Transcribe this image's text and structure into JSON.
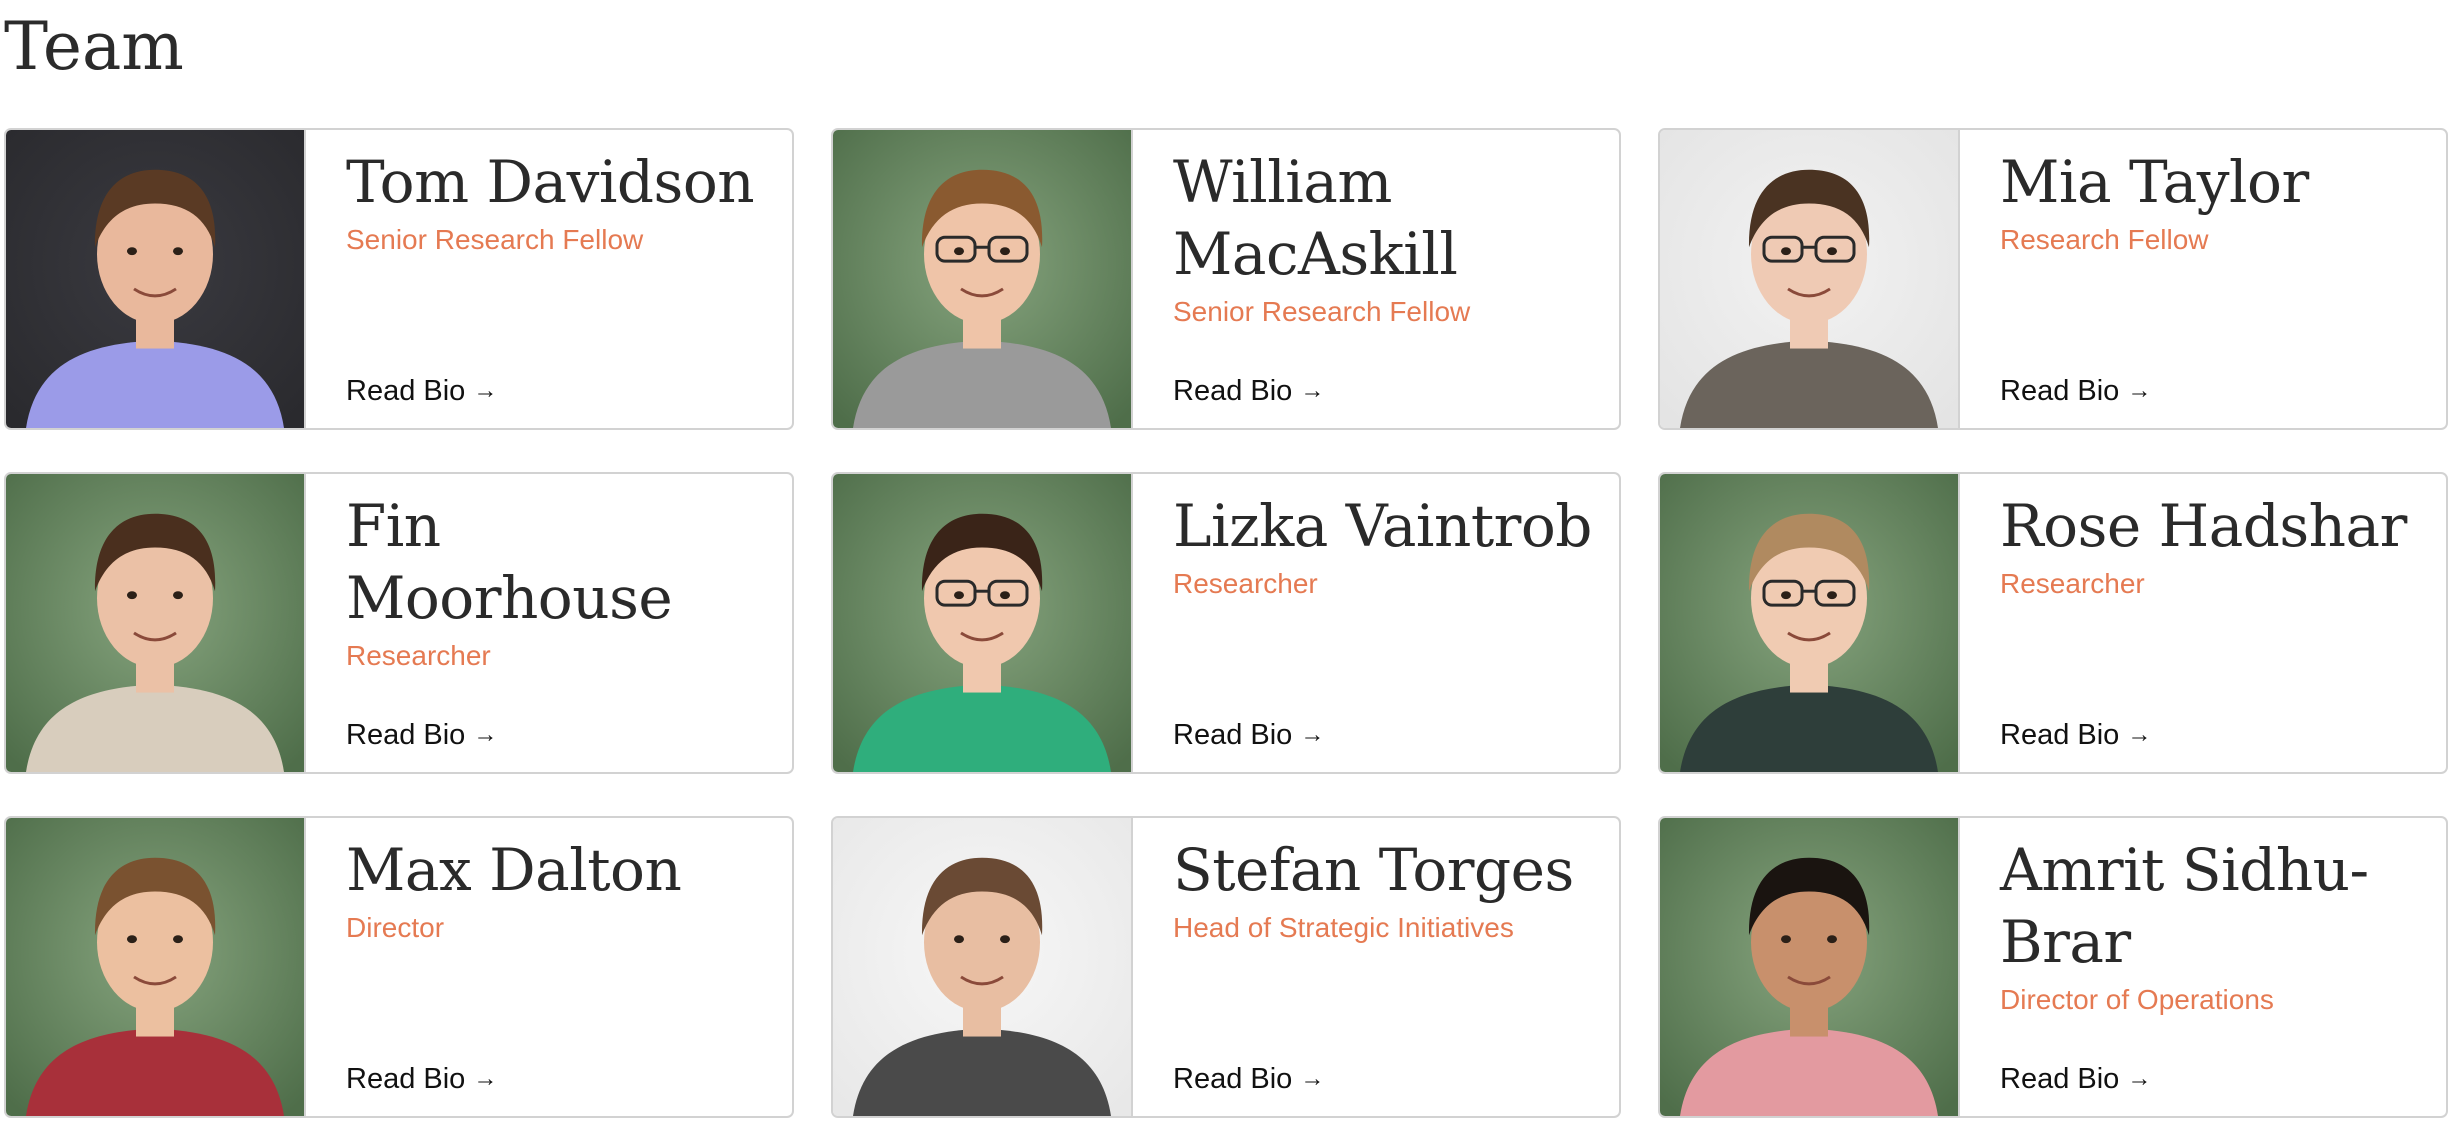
{
  "page": {
    "title": "Team"
  },
  "read_bio_label": "Read Bio",
  "read_bio_arrow": "→",
  "members": [
    {
      "name": "Tom Davidson",
      "role": "Senior Research Fellow",
      "bg": "#2a2a2e",
      "bg_light": "#3a3a40",
      "shirt": "#9b9be8",
      "hair": "#5a3a24",
      "skin": "#e9b89c",
      "glasses": false
    },
    {
      "name": "William MacAskill",
      "role": "Senior Research Fellow",
      "bg": "#4f6e4a",
      "bg_light": "#86a47e",
      "shirt": "#9a9a9a",
      "hair": "#8a5a30",
      "skin": "#efc4a8",
      "glasses": true
    },
    {
      "name": "Mia Taylor",
      "role": "Research Fellow",
      "bg": "#e4e4e4",
      "bg_light": "#f2f2f2",
      "shirt": "#6b645c",
      "hair": "#4a3322",
      "skin": "#efcab4",
      "glasses": true
    },
    {
      "name": "Fin Moorhouse",
      "role": "Researcher",
      "bg": "#4f6e4a",
      "bg_light": "#86a47e",
      "shirt": "#d8cdbd",
      "hair": "#4a2f1e",
      "skin": "#ebc1a6",
      "glasses": false
    },
    {
      "name": "Lizka Vaintrob",
      "role": "Researcher",
      "bg": "#4f6e4a",
      "bg_light": "#86a47e",
      "shirt": "#2fae7c",
      "hair": "#3a2418",
      "skin": "#f0c8ae",
      "glasses": true
    },
    {
      "name": "Rose Hadshar",
      "role": "Researcher",
      "bg": "#4f6e4a",
      "bg_light": "#86a47e",
      "shirt": "#2e3e3a",
      "hair": "#b08a60",
      "skin": "#f0cbb2",
      "glasses": true
    },
    {
      "name": "Max Dalton",
      "role": "Director",
      "bg": "#4f6e4a",
      "bg_light": "#86a47e",
      "shirt": "#a8303a",
      "hair": "#7a5230",
      "skin": "#ecc0a0",
      "glasses": false
    },
    {
      "name": "Stefan Torges",
      "role": "Head of Strategic Initiatives",
      "bg": "#e8e8e8",
      "bg_light": "#f7f7f7",
      "shirt": "#4a4a4a",
      "hair": "#6a4a34",
      "skin": "#e8bea2",
      "glasses": false
    },
    {
      "name": "Amrit Sidhu-Brar",
      "role": "Director of Operations",
      "bg": "#4f6e4a",
      "bg_light": "#86a47e",
      "shirt": "#e39aa0",
      "hair": "#1a1410",
      "skin": "#c8906c",
      "glasses": false
    }
  ]
}
